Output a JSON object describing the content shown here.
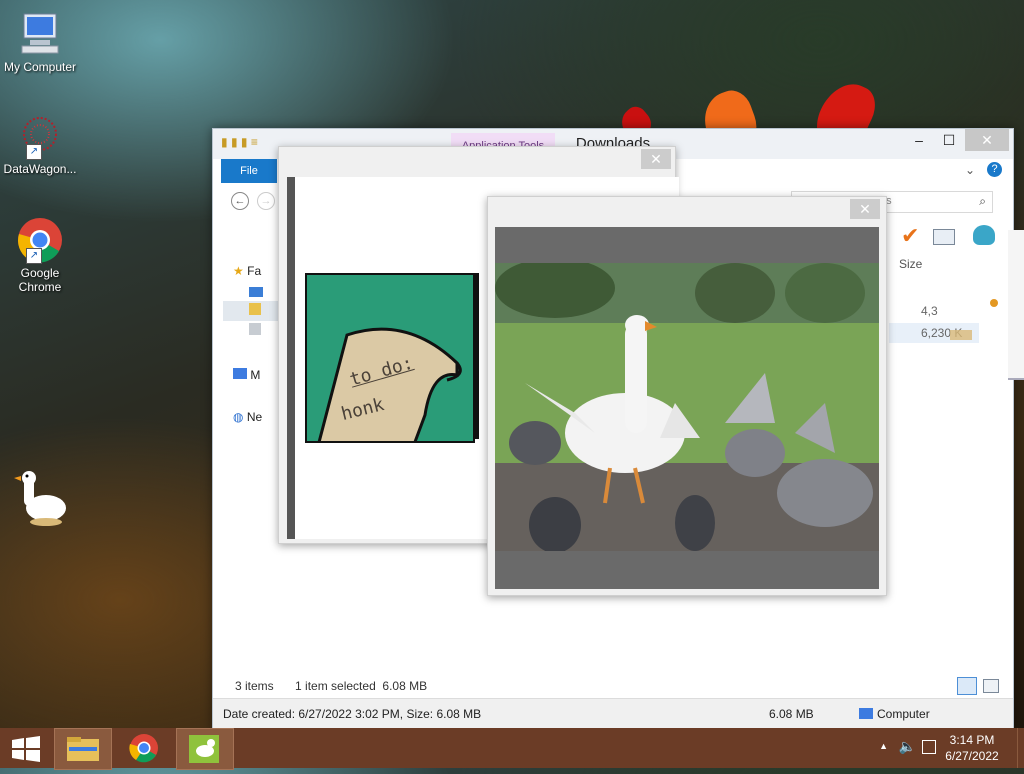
{
  "desktop": {
    "icons": [
      {
        "label": "My Computer",
        "icon": "computer-icon"
      },
      {
        "label": "DataWagon...",
        "icon": "datawagon-icon"
      },
      {
        "label": "Google Chrome",
        "icon": "chrome-icon"
      },
      {
        "label": "",
        "icon": "goose-icon"
      }
    ]
  },
  "explorer": {
    "title": "Downloads",
    "context_tab": "Application Tools",
    "file_tab": "File",
    "search_placeholder": "ds",
    "nav_items": [
      {
        "label": "Fa",
        "icon": "star-icon"
      },
      {
        "label": "",
        "icon": "desktop-folder-icon"
      },
      {
        "label": "",
        "icon": "downloads-folder-icon"
      },
      {
        "label": "",
        "icon": "recent-places-icon"
      },
      {
        "label": "M",
        "icon": "computer-icon"
      },
      {
        "label": "Ne",
        "icon": "network-icon"
      }
    ],
    "columns": {
      "size": "Size"
    },
    "rows": [
      {
        "size": "4,3"
      },
      {
        "size": "6,230 K"
      }
    ],
    "status_items": "3 items",
    "status_selected": "1 item selected  6.08 MB",
    "details": {
      "date_created": "Date created: 6/27/2022 3:02 PM, Size: 6.08 MB",
      "size": "6.08 MB",
      "location": "Computer"
    }
  },
  "note_popup": {
    "note_line1": "to do:",
    "note_line2": "honk"
  },
  "photo_popup": {
    "image_description": "goose-and-pigeons-photo"
  },
  "taskbar": {
    "items": [
      {
        "icon": "start-icon"
      },
      {
        "icon": "file-explorer-icon"
      },
      {
        "icon": "chrome-icon"
      },
      {
        "icon": "goose-app-icon"
      }
    ],
    "time": "3:14 PM",
    "date": "6/27/2022"
  },
  "colors": {
    "taskbar": "#6b3c26",
    "file_tab": "#1979ca",
    "note_bg": "#2a9c78",
    "context_tab": "#f1ddf6"
  }
}
